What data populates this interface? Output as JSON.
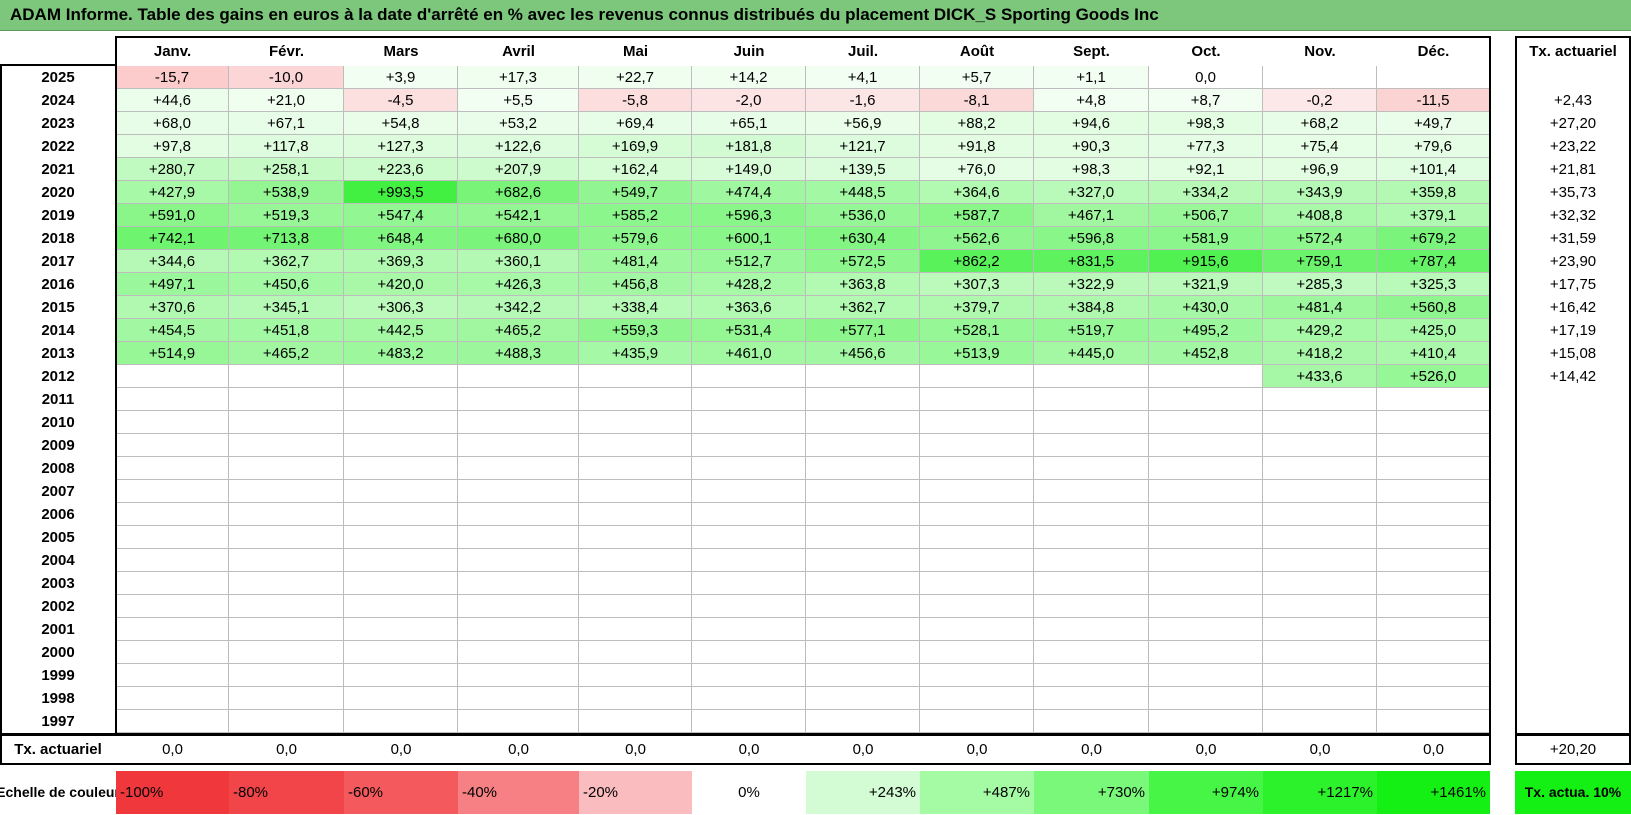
{
  "title": "ADAM Informe. Table des gains en euros à la date d'arrêté en % avec les revenus connus distribués du placement DICK_S Sporting Goods Inc",
  "chart_data": {
    "type": "table",
    "months": [
      "Janv.",
      "Févr.",
      "Mars",
      "Avril",
      "Mai",
      "Juin",
      "Juil.",
      "Août",
      "Sept.",
      "Oct.",
      "Nov.",
      "Déc."
    ],
    "rate_header": "Tx. actuariel",
    "rows": [
      {
        "year": "2025",
        "values": [
          "-15,7",
          "-10,0",
          "+3,9",
          "+17,3",
          "+22,7",
          "+14,2",
          "+4,1",
          "+5,7",
          "+1,1",
          "0,0",
          "",
          ""
        ],
        "rate": ""
      },
      {
        "year": "2024",
        "values": [
          "+44,6",
          "+21,0",
          "-4,5",
          "+5,5",
          "-5,8",
          "-2,0",
          "-1,6",
          "-8,1",
          "+4,8",
          "+8,7",
          "-0,2",
          "-11,5"
        ],
        "rate": "+2,43"
      },
      {
        "year": "2023",
        "values": [
          "+68,0",
          "+67,1",
          "+54,8",
          "+53,2",
          "+69,4",
          "+65,1",
          "+56,9",
          "+88,2",
          "+94,6",
          "+98,3",
          "+68,2",
          "+49,7"
        ],
        "rate": "+27,20"
      },
      {
        "year": "2022",
        "values": [
          "+97,8",
          "+117,8",
          "+127,3",
          "+122,6",
          "+169,9",
          "+181,8",
          "+121,7",
          "+91,8",
          "+90,3",
          "+77,3",
          "+75,4",
          "+79,6"
        ],
        "rate": "+23,22"
      },
      {
        "year": "2021",
        "values": [
          "+280,7",
          "+258,1",
          "+223,6",
          "+207,9",
          "+162,4",
          "+149,0",
          "+139,5",
          "+76,0",
          "+98,3",
          "+92,1",
          "+96,9",
          "+101,4"
        ],
        "rate": "+21,81"
      },
      {
        "year": "2020",
        "values": [
          "+427,9",
          "+538,9",
          "+993,5",
          "+682,6",
          "+549,7",
          "+474,4",
          "+448,5",
          "+364,6",
          "+327,0",
          "+334,2",
          "+343,9",
          "+359,8"
        ],
        "rate": "+35,73"
      },
      {
        "year": "2019",
        "values": [
          "+591,0",
          "+519,3",
          "+547,4",
          "+542,1",
          "+585,2",
          "+596,3",
          "+536,0",
          "+587,7",
          "+467,1",
          "+506,7",
          "+408,8",
          "+379,1"
        ],
        "rate": "+32,32"
      },
      {
        "year": "2018",
        "values": [
          "+742,1",
          "+713,8",
          "+648,4",
          "+680,0",
          "+579,6",
          "+600,1",
          "+630,4",
          "+562,6",
          "+596,8",
          "+581,9",
          "+572,4",
          "+679,2"
        ],
        "rate": "+31,59"
      },
      {
        "year": "2017",
        "values": [
          "+344,6",
          "+362,7",
          "+369,3",
          "+360,1",
          "+481,4",
          "+512,7",
          "+572,5",
          "+862,2",
          "+831,5",
          "+915,6",
          "+759,1",
          "+787,4"
        ],
        "rate": "+23,90"
      },
      {
        "year": "2016",
        "values": [
          "+497,1",
          "+450,6",
          "+420,0",
          "+426,3",
          "+456,8",
          "+428,2",
          "+363,8",
          "+307,3",
          "+322,9",
          "+321,9",
          "+285,3",
          "+325,3"
        ],
        "rate": "+17,75"
      },
      {
        "year": "2015",
        "values": [
          "+370,6",
          "+345,1",
          "+306,3",
          "+342,2",
          "+338,4",
          "+363,6",
          "+362,7",
          "+379,7",
          "+384,8",
          "+430,0",
          "+481,4",
          "+560,8"
        ],
        "rate": "+16,42"
      },
      {
        "year": "2014",
        "values": [
          "+454,5",
          "+451,8",
          "+442,5",
          "+465,2",
          "+559,3",
          "+531,4",
          "+577,1",
          "+528,1",
          "+519,7",
          "+495,2",
          "+429,2",
          "+425,0"
        ],
        "rate": "+17,19"
      },
      {
        "year": "2013",
        "values": [
          "+514,9",
          "+465,2",
          "+483,2",
          "+488,3",
          "+435,9",
          "+461,0",
          "+456,6",
          "+513,9",
          "+445,0",
          "+452,8",
          "+418,2",
          "+410,4"
        ],
        "rate": "+15,08"
      },
      {
        "year": "2012",
        "values": [
          "",
          "",
          "",
          "",
          "",
          "",
          "",
          "",
          "",
          "",
          "+433,6",
          "+526,0"
        ],
        "rate": "+14,42"
      },
      {
        "year": "2011",
        "values": [
          "",
          "",
          "",
          "",
          "",
          "",
          "",
          "",
          "",
          "",
          "",
          ""
        ],
        "rate": ""
      },
      {
        "year": "2010",
        "values": [
          "",
          "",
          "",
          "",
          "",
          "",
          "",
          "",
          "",
          "",
          "",
          ""
        ],
        "rate": ""
      },
      {
        "year": "2009",
        "values": [
          "",
          "",
          "",
          "",
          "",
          "",
          "",
          "",
          "",
          "",
          "",
          ""
        ],
        "rate": ""
      },
      {
        "year": "2008",
        "values": [
          "",
          "",
          "",
          "",
          "",
          "",
          "",
          "",
          "",
          "",
          "",
          ""
        ],
        "rate": ""
      },
      {
        "year": "2007",
        "values": [
          "",
          "",
          "",
          "",
          "",
          "",
          "",
          "",
          "",
          "",
          "",
          ""
        ],
        "rate": ""
      },
      {
        "year": "2006",
        "values": [
          "",
          "",
          "",
          "",
          "",
          "",
          "",
          "",
          "",
          "",
          "",
          ""
        ],
        "rate": ""
      },
      {
        "year": "2005",
        "values": [
          "",
          "",
          "",
          "",
          "",
          "",
          "",
          "",
          "",
          "",
          "",
          ""
        ],
        "rate": ""
      },
      {
        "year": "2004",
        "values": [
          "",
          "",
          "",
          "",
          "",
          "",
          "",
          "",
          "",
          "",
          "",
          ""
        ],
        "rate": ""
      },
      {
        "year": "2003",
        "values": [
          "",
          "",
          "",
          "",
          "",
          "",
          "",
          "",
          "",
          "",
          "",
          ""
        ],
        "rate": ""
      },
      {
        "year": "2002",
        "values": [
          "",
          "",
          "",
          "",
          "",
          "",
          "",
          "",
          "",
          "",
          "",
          ""
        ],
        "rate": ""
      },
      {
        "year": "2001",
        "values": [
          "",
          "",
          "",
          "",
          "",
          "",
          "",
          "",
          "",
          "",
          "",
          ""
        ],
        "rate": ""
      },
      {
        "year": "2000",
        "values": [
          "",
          "",
          "",
          "",
          "",
          "",
          "",
          "",
          "",
          "",
          "",
          ""
        ],
        "rate": ""
      },
      {
        "year": "1999",
        "values": [
          "",
          "",
          "",
          "",
          "",
          "",
          "",
          "",
          "",
          "",
          "",
          ""
        ],
        "rate": ""
      },
      {
        "year": "1998",
        "values": [
          "",
          "",
          "",
          "",
          "",
          "",
          "",
          "",
          "",
          "",
          "",
          ""
        ],
        "rate": ""
      },
      {
        "year": "1997",
        "values": [
          "",
          "",
          "",
          "",
          "",
          "",
          "",
          "",
          "",
          "",
          "",
          ""
        ],
        "rate": ""
      }
    ],
    "footer": {
      "label": "Tx. actuariel",
      "values": [
        "0,0",
        "0,0",
        "0,0",
        "0,0",
        "0,0",
        "0,0",
        "0,0",
        "0,0",
        "0,0",
        "0,0",
        "0,0",
        "0,0"
      ],
      "rate": "+20,20"
    },
    "color_scale": {
      "label": "Echelle de couleur",
      "steps": [
        {
          "label": "-100%",
          "color": "#f0373c"
        },
        {
          "label": "-80%",
          "color": "#f24549"
        },
        {
          "label": "-60%",
          "color": "#f45a5d"
        },
        {
          "label": "-40%",
          "color": "#f68083"
        },
        {
          "label": "-20%",
          "color": "#fabcbe"
        },
        {
          "label": "0%",
          "color": "#ffffff"
        },
        {
          "label": "+243%",
          "color": "#d4fcd4"
        },
        {
          "label": "+487%",
          "color": "#a4fba4"
        },
        {
          "label": "+730%",
          "color": "#79f879"
        },
        {
          "label": "+974%",
          "color": "#47f547"
        },
        {
          "label": "+1217%",
          "color": "#2cf22c"
        },
        {
          "label": "+1461%",
          "color": "#14ef14"
        }
      ],
      "rate_note": "Tx. actua. 10%",
      "rate_note_color": "#14ef14"
    },
    "colors": {
      "title_bar": "#7dc77d",
      "negative": "#fcdcdc",
      "positive_base": "#f3fef3"
    }
  }
}
